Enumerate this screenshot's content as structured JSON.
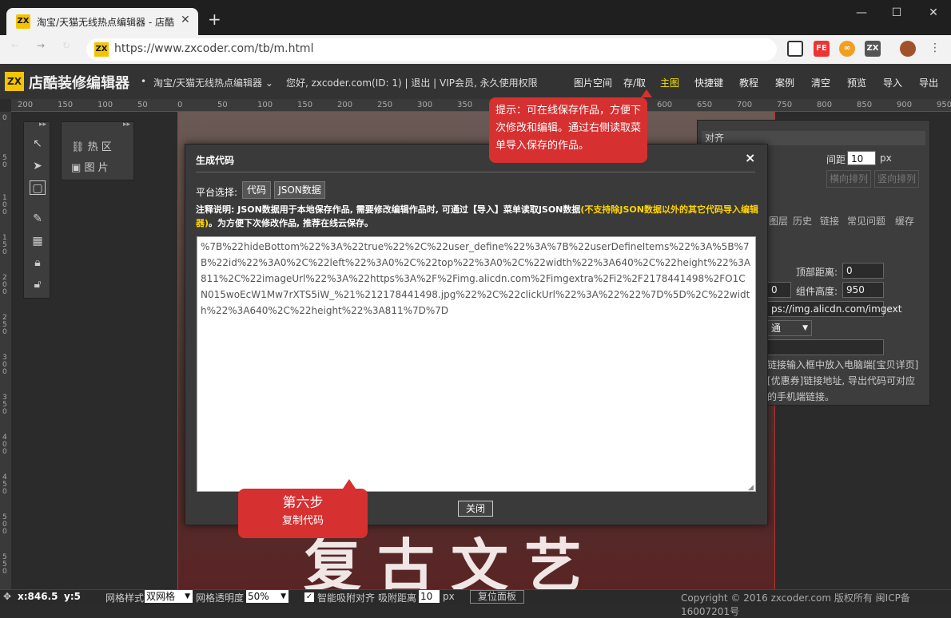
{
  "browser": {
    "tab_title": "淘宝/天猫无线热点编辑器 - 店酷",
    "tab_favicon": "ZX",
    "new_tab": "+",
    "url": "https://www.zxcoder.com/tb/m.html",
    "window_controls": [
      "—",
      "☐",
      "✕"
    ]
  },
  "app": {
    "logo": "ZX",
    "name": "店酷装修编辑器",
    "editor_select": "淘宝/天猫无线热点编辑器",
    "user_info": "您好, zxcoder.com(ID: 1) | 退出 | VIP会员, 永久使用权限",
    "menu": [
      "图片空间",
      "存/取",
      "主图",
      "快捷键",
      "教程",
      "案例",
      "清空",
      "预览",
      "导入",
      "导出"
    ]
  },
  "ruler": {
    "h_labels": [
      "200",
      "150",
      "100",
      "50",
      "0",
      "50",
      "100",
      "150",
      "200",
      "250",
      "300",
      "350",
      "400",
      "450",
      "500",
      "550",
      "600",
      "650",
      "700",
      "750",
      "800",
      "850",
      "900",
      "950"
    ],
    "v_labels": [
      "0",
      "50",
      "100",
      "150",
      "200",
      "250",
      "300",
      "350",
      "400",
      "450",
      "500",
      "550"
    ]
  },
  "hot_panel": {
    "items": [
      "热 区",
      "图 片"
    ]
  },
  "right_panel": {
    "header": "对齐",
    "spacing_label": "间距",
    "spacing_value": "10",
    "spacing_unit": "px",
    "btn_h": "横向排列",
    "btn_v": "竖向排列",
    "tabs": [
      "图层",
      "历史",
      "链接",
      "常见问题",
      "缓存"
    ],
    "top_distance_label": "顶部距离:",
    "top_distance_value": "0",
    "component_height_label": "组件高度:",
    "component_height_value": "950",
    "left_value_1": "",
    "left_value_2": "0",
    "image_url": "ps://img.alicdn.com/imgext",
    "select_value": "通",
    "help_text": "链接输入框中放入电脑端[宝贝详页][优惠券]链接地址, 导出代码可对应的手机端链接。"
  },
  "modal": {
    "title": "生成代码",
    "close": "×",
    "platform_label": "平台选择:",
    "platform_btn_code": "代码",
    "platform_btn_json": "JSON数据",
    "note_prefix": "注释说明: JSON数据用于本地保存作品, 需要修改编辑作品时, 可通过【导入】菜单读取JSON数据",
    "note_highlight": "(不支持除JSON数据以外的其它代码导入编辑器)",
    "note_suffix": "。为方便下次修改作品, 推荐在线云保存。",
    "code": "%7B%22hideBottom%22%3A%22true%22%2C%22user_define%22%3A%7B%22userDefineItems%22%3A%5B%7B%22id%22%3A0%2C%22left%22%3A0%2C%22top%22%3A0%2C%22width%22%3A640%2C%22height%22%3A811%2C%22imageUrl%22%3A%22https%3A%2F%2Fimg.alicdn.com%2Fimgextra%2Fi2%2F2178441498%2FO1CN015woEcW1Mw7rXTS5iW_%21%212178441498.jpg%22%2C%22clickUrl%22%3A%22%22%7D%5D%2C%22width%22%3A640%2C%22height%22%3A811%7D%7D",
    "close_button": "关闭"
  },
  "callouts": {
    "tip": "提示：可在线保存作品，方便下次修改和编辑。通过右侧读取菜单导入保存的作品。",
    "step_title": "第六步",
    "step_desc": "复制代码"
  },
  "canvas_art_text": "复古文艺",
  "statusbar": {
    "x": "x:846.5",
    "y": "y:5",
    "grid_style_label": "网格样式",
    "grid_style_value": "双网格",
    "grid_opacity_label": "网格透明度",
    "grid_opacity_value": "50%",
    "snap_label": "智能吸附对齐",
    "snap_distance_label": "吸附距离",
    "snap_distance_value": "10",
    "snap_unit": "px",
    "reset_panel": "复位面板",
    "copyright": "Copyright © 2016 zxcoder.com 版权所有 闽ICP备16007201号"
  },
  "colors": {
    "accent_red": "#d63031",
    "logo_yellow": "#f5c400",
    "menu_active": "#f5e400",
    "note_highlight": "#ffd400"
  }
}
